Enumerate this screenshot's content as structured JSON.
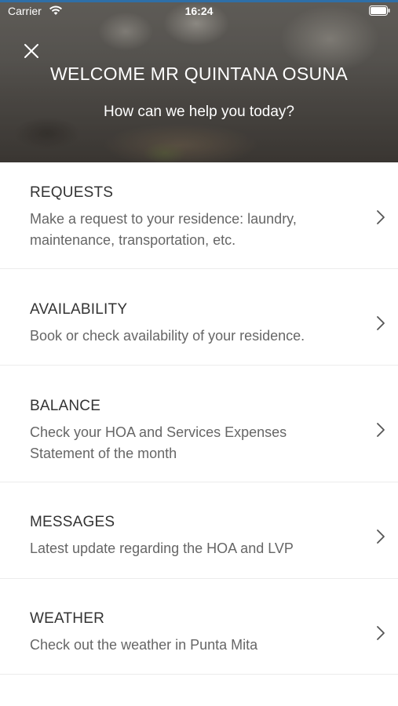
{
  "status_bar": {
    "carrier": "Carrier",
    "time": "16:24"
  },
  "header": {
    "title": "WELCOME MR QUINTANA OSUNA",
    "subtitle": "How can we help you today?",
    "close_icon": "close-icon"
  },
  "colors": {
    "accent": "#2f6fa8",
    "title_text": "#333333",
    "description_text": "#666666",
    "divider": "#ececec"
  },
  "menu": {
    "items": [
      {
        "title": "REQUESTS",
        "description": "Make a request to your residence: laundry,\nmaintenance, transportation, etc.",
        "icon": "chevron-right-icon"
      },
      {
        "title": "AVAILABILITY",
        "description": "Book or check availability of your residence.",
        "icon": "chevron-right-icon"
      },
      {
        "title": "BALANCE",
        "description": "Check your HOA and Services Expenses\nStatement  of the month",
        "icon": "chevron-right-icon"
      },
      {
        "title": "MESSAGES",
        "description": "Latest update regarding the HOA and LVP",
        "icon": "chevron-right-icon"
      },
      {
        "title": "WEATHER",
        "description": "Check out the weather in Punta Mita",
        "icon": "chevron-right-icon"
      }
    ]
  }
}
